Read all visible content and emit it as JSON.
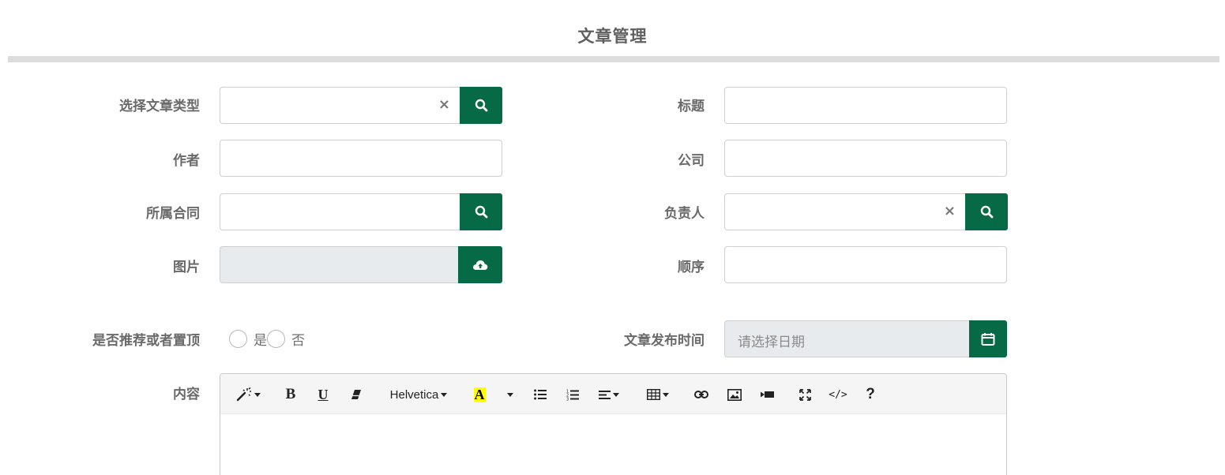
{
  "page": {
    "title": "文章管理"
  },
  "form": {
    "article_type": {
      "label": "选择文章类型",
      "value": "",
      "clear_icon": "×",
      "search_icon": "search-icon"
    },
    "title": {
      "label": "标题",
      "value": ""
    },
    "author": {
      "label": "作者",
      "value": ""
    },
    "company": {
      "label": "公司",
      "value": ""
    },
    "contract": {
      "label": "所属合同",
      "value": "",
      "search_icon": "search-icon"
    },
    "owner": {
      "label": "负责人",
      "value": "",
      "clear_icon": "×",
      "search_icon": "search-icon"
    },
    "image": {
      "label": "图片",
      "value": "",
      "upload_icon": "cloud-upload-icon"
    },
    "order": {
      "label": "顺序",
      "value": ""
    },
    "recommend": {
      "label": "是否推荐或者置顶",
      "options": [
        "是",
        "否"
      ],
      "selected": null
    },
    "publish_time": {
      "label": "文章发布时间",
      "placeholder": "请选择日期",
      "calendar_icon": "calendar-icon"
    },
    "content": {
      "label": "内容",
      "toolbar": {
        "style": "magic-wand-icon",
        "bold": "B",
        "underline": "U",
        "clear_format": "eraser-icon",
        "font_name": "Helvetica",
        "font_color": "A",
        "unordered_list": "ul-icon",
        "ordered_list": "ol-icon",
        "paragraph": "align-left-icon",
        "table": "table-icon",
        "link": "link-icon",
        "picture": "picture-icon",
        "video": "video-icon",
        "fullscreen": "fullscreen-icon",
        "code_view": "</>",
        "help": "?"
      }
    }
  },
  "colors": {
    "accent": "#076a47",
    "title_bar": "#dcdcdc",
    "disabled_bg": "#e8ebee"
  }
}
